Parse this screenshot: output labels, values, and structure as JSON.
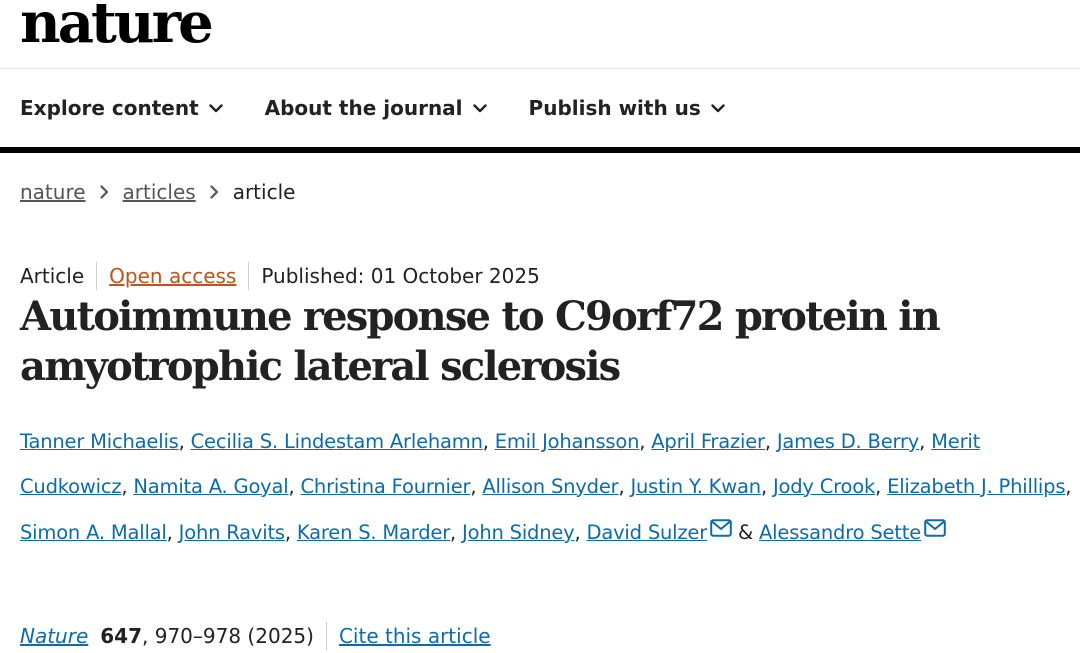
{
  "masthead": {
    "logo": "nature"
  },
  "nav": {
    "items": [
      {
        "label": "Explore content"
      },
      {
        "label": "About the journal"
      },
      {
        "label": "Publish with us"
      }
    ]
  },
  "breadcrumb": {
    "items": [
      "nature",
      "articles"
    ],
    "current": "article"
  },
  "article": {
    "type": "Article",
    "access": "Open access",
    "published": "Published: 01 October 2025",
    "title": "Autoimmune response to C9orf72 protein in amyotrophic lateral sclerosis",
    "authors": [
      "Tanner Michaelis",
      "Cecilia S. Lindestam Arlehamn",
      "Emil Johansson",
      "April Frazier",
      "James D. Berry",
      "Merit Cudkowicz",
      "Namita A. Goyal",
      "Christina Fournier",
      "Allison Snyder",
      "Justin Y. Kwan",
      "Jody Crook",
      "Elizabeth J. Phillips",
      "Simon A. Mallal",
      "John Ravits",
      "Karen S. Marder",
      "John Sidney",
      "David Sulzer",
      "Alessandro Sette"
    ],
    "author_separator": ", ",
    "author_ampersand": " & ",
    "citation": {
      "journal": "Nature",
      "volume": "647",
      "pages_year": ", 970–978 (2025)",
      "cite_label": "Cite this article"
    }
  },
  "colors": {
    "link": "#0d6bab",
    "open_access": "#c0531a",
    "text": "#222222"
  }
}
